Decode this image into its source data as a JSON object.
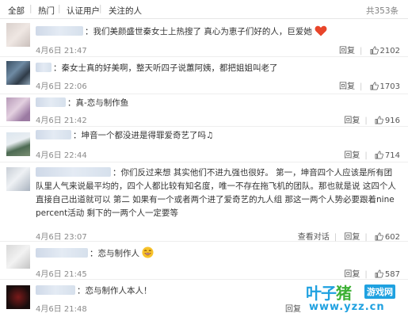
{
  "filter_tabs": {
    "all": "全部",
    "sep": "|",
    "popular": "热门",
    "verified": "认证用户",
    "following": "关注的人",
    "total_count": "共353条"
  },
  "comments": [
    {
      "text": "：我们美颜盛世秦女士上热搜了 真心为恵子们好的人，巨爱她",
      "time_prefix": "4月6日",
      "time": "21:47",
      "reply_label": "回复",
      "likes": "2102",
      "emoji": "heart-icon"
    },
    {
      "text": "：秦女士真的好美啊，整天听四子说蕙阿姨，都把姐姐叫老了",
      "time_prefix": "4月6日",
      "time": "22:06",
      "reply_label": "回复",
      "likes": "1703"
    },
    {
      "text": "：真-恋与制作鱼",
      "time_prefix": "4月6日",
      "time": "21:42",
      "reply_label": "回复",
      "likes": "916"
    },
    {
      "text": "：坤音一个都没进是得罪爱奇艺了吗♫",
      "time_prefix": "4月6日",
      "time": "22:44",
      "reply_label": "回复",
      "likes": "714"
    },
    {
      "text": "：你们反过来想 其实他们不进九强也很好。 第一，坤音四个人应该是所有团队里人气来说最平均的，四个人都比较有知名度，唯一不存在拖飞机的团队。那也就是说 这四个人直接自己出道就可以 第二 如果有一个或者两个进了爱奇艺的九人组 那这一两个人势必要跟着nine percent活动 剩下的一两个人一定要等",
      "time_prefix": "4月6日",
      "time": "23:07",
      "view_replies_label": "查看对话",
      "reply_label": "回复",
      "likes": "602"
    },
    {
      "text": "：恋与制作人",
      "time_prefix": "4月6日",
      "time": "21:45",
      "reply_label": "回复",
      "likes": "587",
      "emoji": "laughing-icon"
    },
    {
      "text": "：恋与制作人本人！",
      "time_prefix": "4月6日",
      "time": "21:48",
      "reply_label": "回复"
    }
  ],
  "watermark": {
    "brand_a": "叶子",
    "brand_b": "猪",
    "brand_box": "游戏网",
    "url": "www.yzz.cn"
  },
  "colors": {
    "link_blue": "#eb7350",
    "brand_blue": "#1fa1e0",
    "brand_green": "#3cb034",
    "heart_red": "#e8452a"
  }
}
